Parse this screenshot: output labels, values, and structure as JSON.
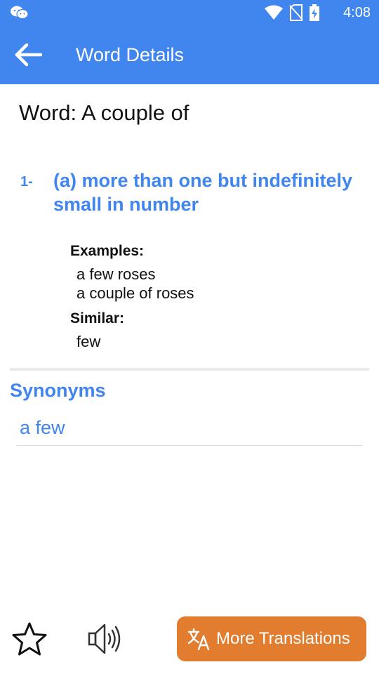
{
  "status_bar": {
    "time": "4:08"
  },
  "app_bar": {
    "title": "Word Details"
  },
  "word": {
    "line": "Word: A couple of"
  },
  "definition": {
    "number": "1-",
    "text": "(a) more than one but indefinitely small in number",
    "examples_label": "Examples:",
    "examples": [
      "a few roses",
      "a couple of roses"
    ],
    "similar_label": "Similar:",
    "similar": [
      "few"
    ]
  },
  "synonyms": {
    "heading": "Synonyms",
    "items": [
      "a few"
    ]
  },
  "bottom": {
    "more_translations_label": "More Translations"
  },
  "colors": {
    "primary": "#4185ee",
    "accent": "#e27c2f"
  },
  "icons": [
    "wechat-icon",
    "wifi-icon",
    "no-sim-icon",
    "battery-charging-icon",
    "back-arrow-icon",
    "star-icon",
    "speaker-icon",
    "translate-icon"
  ]
}
